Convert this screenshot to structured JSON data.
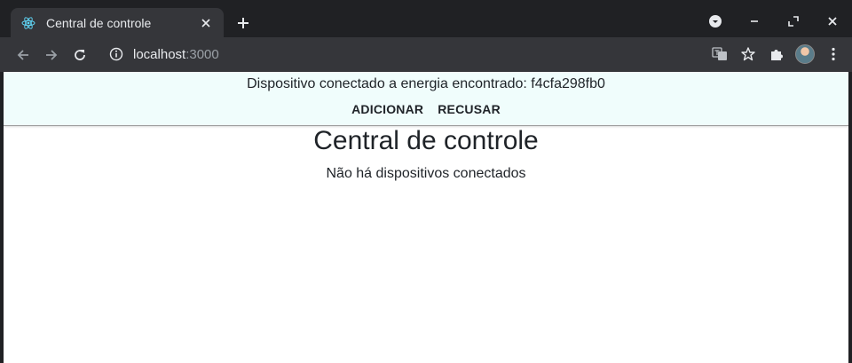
{
  "browser": {
    "tab": {
      "title": "Central de controle"
    },
    "address": {
      "host": "localhost",
      "port": ":3000"
    }
  },
  "snackbar": {
    "message": "Dispositivo conectado a energia encontrado: f4cfa298fb0",
    "add_label": "ADICIONAR",
    "reject_label": "RECUSAR"
  },
  "main": {
    "title": "Central de controle",
    "empty_message": "Não há dispositivos conectados"
  },
  "colors": {
    "snackbar_bg": "#f0fdfc",
    "chrome_dark": "#202124",
    "toolbar": "#35363a",
    "react_blue": "#61dafb"
  }
}
